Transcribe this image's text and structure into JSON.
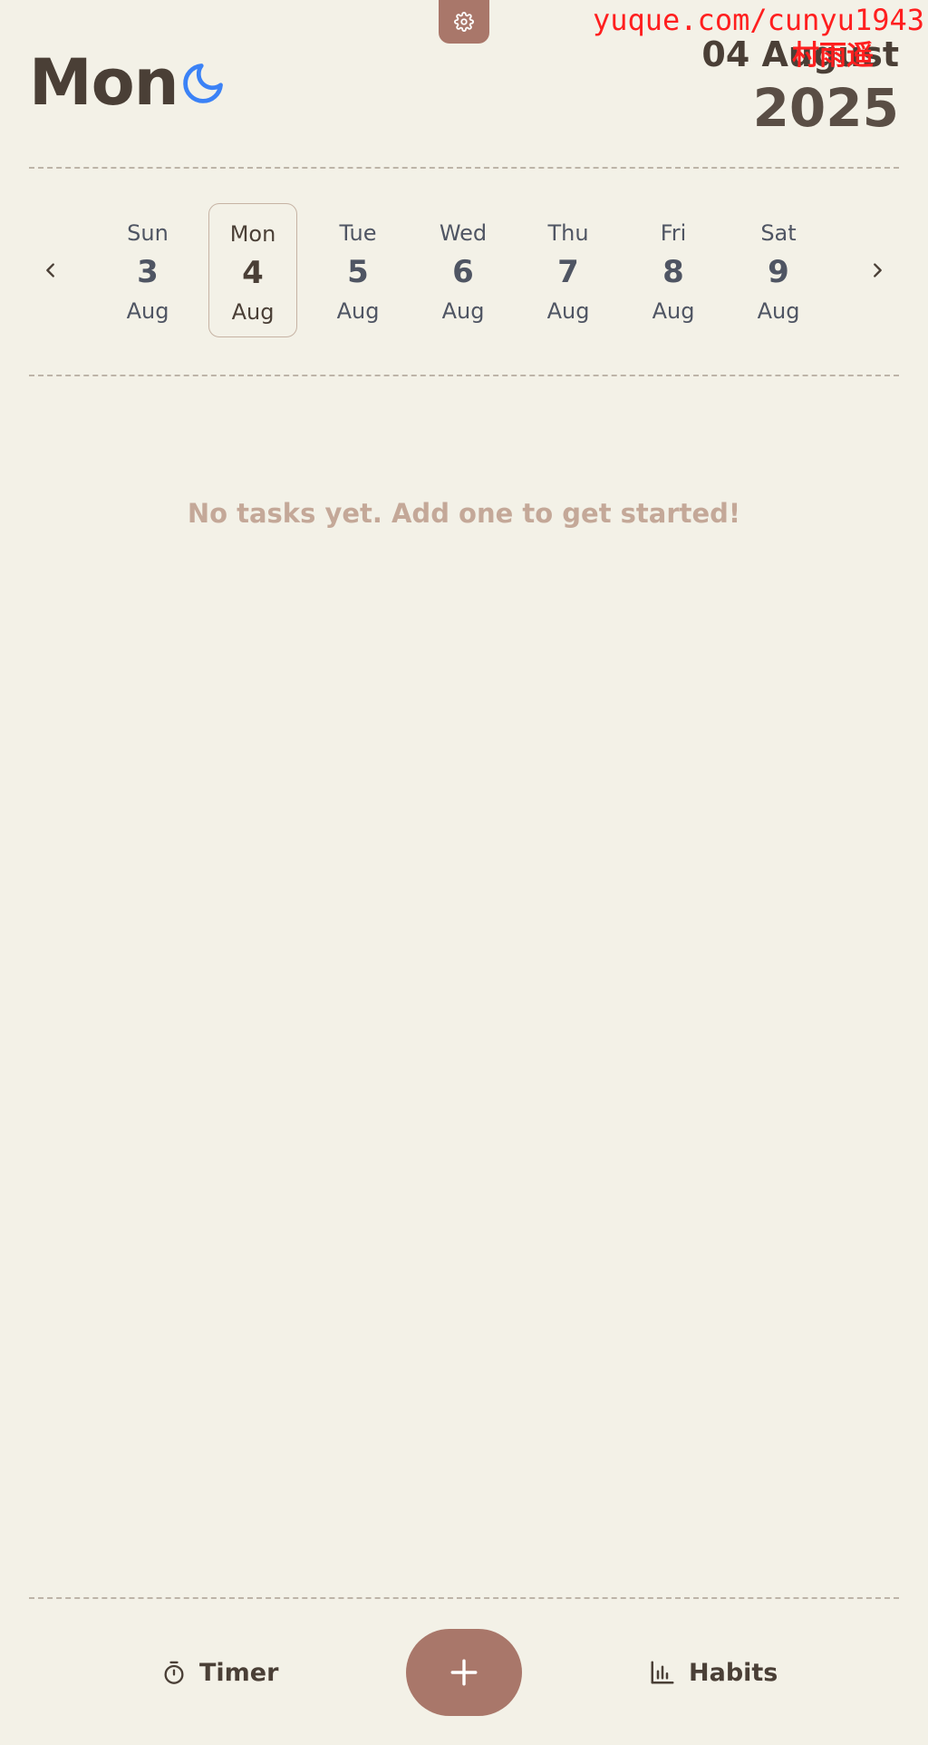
{
  "header": {
    "day_name": "Mon",
    "date_line": "04 August",
    "year": "2025"
  },
  "watermark": {
    "url": "yuque.com/cunyu1943",
    "name": "村雨遥"
  },
  "week": {
    "days": [
      {
        "weekday": "Sun",
        "day": "3",
        "month": "Aug",
        "selected": false
      },
      {
        "weekday": "Mon",
        "day": "4",
        "month": "Aug",
        "selected": true
      },
      {
        "weekday": "Tue",
        "day": "5",
        "month": "Aug",
        "selected": false
      },
      {
        "weekday": "Wed",
        "day": "6",
        "month": "Aug",
        "selected": false
      },
      {
        "weekday": "Thu",
        "day": "7",
        "month": "Aug",
        "selected": false
      },
      {
        "weekday": "Fri",
        "day": "8",
        "month": "Aug",
        "selected": false
      },
      {
        "weekday": "Sat",
        "day": "9",
        "month": "Aug",
        "selected": false
      }
    ]
  },
  "main": {
    "empty_message": "No tasks yet. Add one to get started!"
  },
  "bottom_nav": {
    "timer_label": "Timer",
    "habits_label": "Habits"
  },
  "icons": {
    "settings": "gear-icon",
    "theme": "moon-icon",
    "prev": "chevron-left-icon",
    "next": "chevron-right-icon",
    "timer": "stopwatch-icon",
    "add": "plus-icon",
    "habits": "bar-chart-icon"
  },
  "colors": {
    "background": "#f3f1e7",
    "accent": "#a9776a",
    "text": "#4a3f36",
    "muted_text": "#c4a898",
    "moon": "#3b82f6",
    "watermark": "#ff1f1f"
  }
}
